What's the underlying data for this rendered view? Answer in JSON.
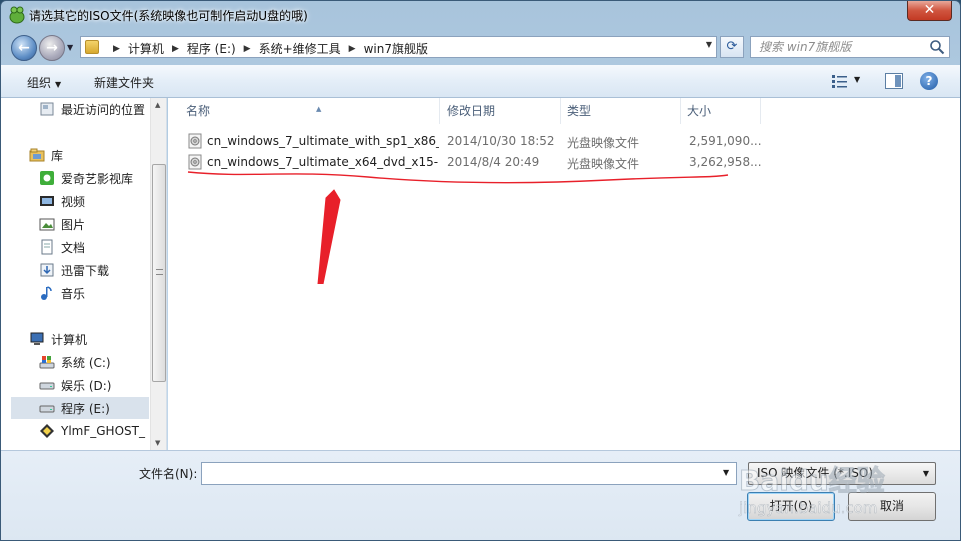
{
  "window": {
    "title": "请选其它的ISO文件(系统映像也可制作启动U盘的哦)"
  },
  "address": {
    "crumbs": [
      "计算机",
      "程序 (E:)",
      "系统+维修工具",
      "win7旗舰版"
    ]
  },
  "search": {
    "placeholder": "搜索 win7旗舰版"
  },
  "toolbar": {
    "organize_label": "组织",
    "newfolder_label": "新建文件夹"
  },
  "navpane": {
    "items": [
      {
        "label": "最近访问的位置",
        "icon": "recent-places-icon"
      },
      {
        "label": "库",
        "icon": "library-icon"
      },
      {
        "label": "爱奇艺影视库",
        "icon": "iqiyi-icon"
      },
      {
        "label": "视频",
        "icon": "video-icon"
      },
      {
        "label": "图片",
        "icon": "pictures-icon"
      },
      {
        "label": "文档",
        "icon": "documents-icon"
      },
      {
        "label": "迅雷下载",
        "icon": "thunder-download-icon"
      },
      {
        "label": "音乐",
        "icon": "music-icon"
      },
      {
        "label": "计算机",
        "icon": "computer-icon"
      },
      {
        "label": "系统 (C:)",
        "icon": "system-drive-icon"
      },
      {
        "label": "娱乐 (D:)",
        "icon": "drive-icon"
      },
      {
        "label": "程序 (E:)",
        "icon": "drive-icon"
      },
      {
        "label": "YlmF_GHOST_ (",
        "icon": "dvd-drive-icon"
      }
    ]
  },
  "filelist": {
    "columns": [
      "名称",
      "修改日期",
      "类型",
      "大小"
    ],
    "rows": [
      {
        "name": "cn_windows_7_ultimate_with_sp1_x86_...",
        "date": "2014/10/30 18:52",
        "type": "光盘映像文件",
        "size": "2,591,090..."
      },
      {
        "name": "cn_windows_7_ultimate_x64_dvd_x15-...",
        "date": "2014/8/4 20:49",
        "type": "光盘映像文件",
        "size": "3,262,958..."
      }
    ]
  },
  "bottom": {
    "filename_label": "文件名(N):",
    "filename_value": "",
    "filetype_value": "ISO 映像文件 (*.ISO)",
    "open_label": "打开(O)",
    "cancel_label": "取消"
  },
  "watermark": {
    "text": "Baidu经验",
    "sub": "jingyan.baidu.com"
  },
  "colors": {
    "annotation": "#e8202a",
    "titlebar": "#b9d1e6",
    "close": "#c33a24"
  }
}
